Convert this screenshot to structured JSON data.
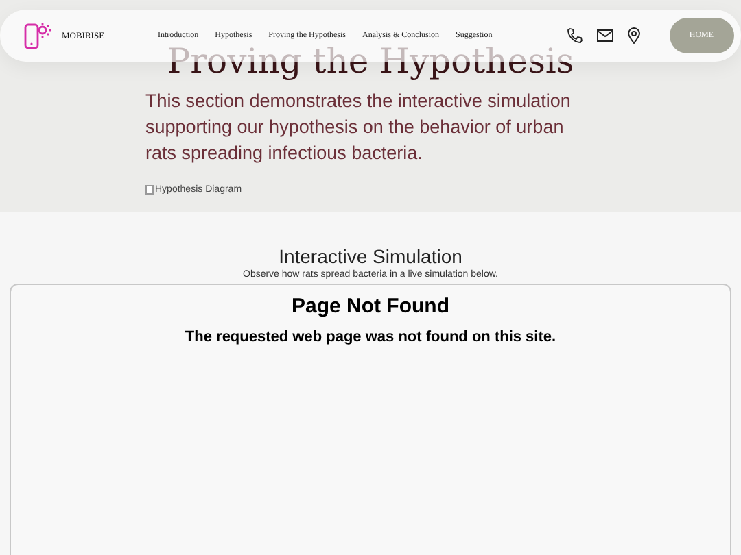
{
  "navbar": {
    "brand": "MOBIRISE",
    "links": [
      {
        "label": "Introduction"
      },
      {
        "label": "Hypothesis"
      },
      {
        "label": "Proving the Hypothesis"
      },
      {
        "label": "Analysis & Conclusion"
      },
      {
        "label": "Suggestion"
      }
    ],
    "button": "HOME"
  },
  "hero": {
    "title": "Proving the Hypothesis",
    "text": "This section demonstrates the interactive simulation supporting our hypothesis on the behavior of urban rats spreading infectious bacteria.",
    "image_alt": "Hypothesis Diagram"
  },
  "simulation": {
    "title": "Interactive Simulation",
    "subtitle": "Observe how rats spread bacteria in a live simulation below.",
    "frame": {
      "heading": "Page Not Found",
      "message": "The requested web page was not found on this site."
    }
  }
}
